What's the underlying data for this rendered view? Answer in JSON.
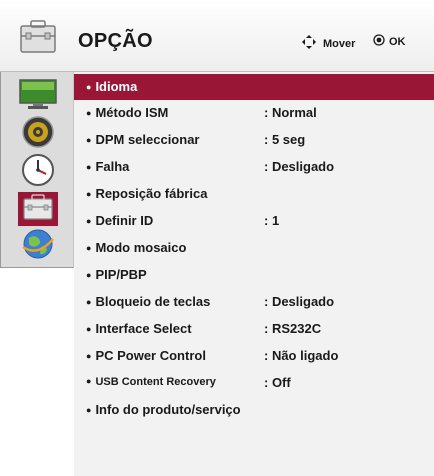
{
  "header": {
    "title": "OPÇÃO",
    "move_label": "Mover",
    "ok_label": "OK",
    "icon": "toolbox-icon"
  },
  "sidebar": {
    "items": [
      {
        "name": "monitor-icon",
        "active": false
      },
      {
        "name": "speaker-icon",
        "active": false
      },
      {
        "name": "clock-icon",
        "active": false
      },
      {
        "name": "toolbox-icon",
        "active": true
      },
      {
        "name": "globe-icon",
        "active": false
      }
    ]
  },
  "menu": {
    "items": [
      {
        "label": "Idioma",
        "value": "",
        "selected": true
      },
      {
        "label": "Método ISM",
        "value": ": Normal"
      },
      {
        "label": "DPM seleccionar",
        "value": ": 5 seg"
      },
      {
        "label": "Falha",
        "value": ": Desligado"
      },
      {
        "label": "Reposição fábrica",
        "value": ""
      },
      {
        "label": "Definir ID",
        "value": ": 1"
      },
      {
        "label": "Modo mosaico",
        "value": ""
      },
      {
        "label": "PIP/PBP",
        "value": ""
      },
      {
        "label": "Bloqueio de teclas",
        "value": ": Desligado"
      },
      {
        "label": "Interface Select",
        "value": ": RS232C"
      },
      {
        "label": "PC Power Control",
        "value": ": Não ligado"
      },
      {
        "label": "USB Content Recovery",
        "value": ": Off"
      },
      {
        "label": "Info do produto/serviço",
        "value": ""
      }
    ]
  },
  "colors": {
    "accent": "#9a1636",
    "panel": "#f2f2f2",
    "sidebar": "#dcdcdc"
  }
}
